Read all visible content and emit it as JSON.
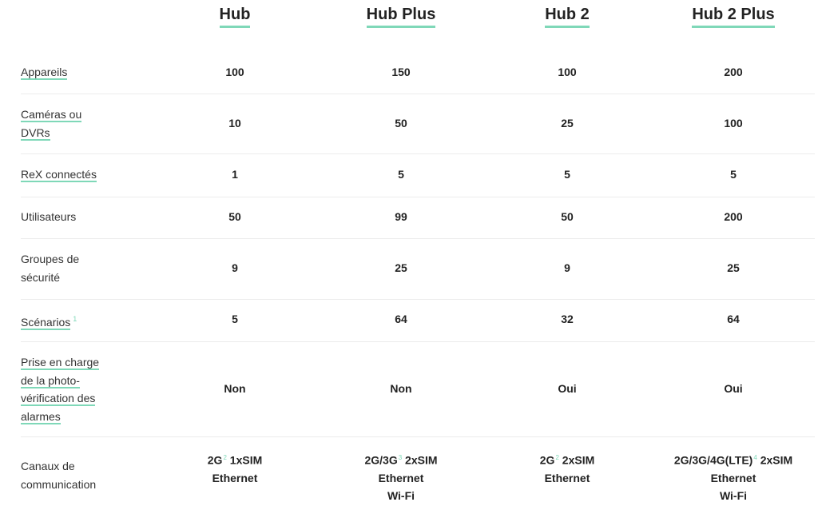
{
  "colors": {
    "accent": "#7fd8b8",
    "divider": "#ececec",
    "text": "#2b2b2b"
  },
  "columns": [
    {
      "label": "Hub"
    },
    {
      "label": "Hub Plus"
    },
    {
      "label": "Hub 2"
    },
    {
      "label": "Hub 2 Plus"
    }
  ],
  "rows": [
    {
      "label": "Appareils",
      "values": [
        "100",
        "150",
        "100",
        "200"
      ]
    },
    {
      "label": "Caméras ou DVRs",
      "values": [
        "10",
        "50",
        "25",
        "100"
      ]
    },
    {
      "label": "ReX connectés",
      "values": [
        "1",
        "5",
        "5",
        "5"
      ]
    },
    {
      "label": "Utilisateurs",
      "values": [
        "50",
        "99",
        "50",
        "200"
      ]
    },
    {
      "label": "Groupes de sécurité",
      "values": [
        "9",
        "25",
        "9",
        "25"
      ]
    },
    {
      "label": "Scénarios",
      "footnote": "1",
      "values": [
        "5",
        "64",
        "32",
        "64"
      ]
    },
    {
      "label": "Prise en charge de la photo-vérification des alarmes",
      "values": [
        "Non",
        "Non",
        "Oui",
        "Oui"
      ]
    },
    {
      "label": "Canaux de communication",
      "cells": [
        {
          "line1": "2G",
          "sup": "2",
          "line1b": " 1xSIM",
          "lines": [
            "Ethernet"
          ]
        },
        {
          "line1": "2G/3G",
          "sup": "3",
          "line1b": " 2xSIM",
          "lines": [
            "Ethernet",
            "Wi-Fi"
          ]
        },
        {
          "line1": "2G",
          "sup": "2",
          "line1b": " 2xSIM",
          "lines": [
            "Ethernet"
          ]
        },
        {
          "line1": "2G/3G/4G(LTE)",
          "sup": "4",
          "line1b": " 2xSIM",
          "lines": [
            "Ethernet",
            "Wi-Fi"
          ]
        }
      ]
    }
  ]
}
